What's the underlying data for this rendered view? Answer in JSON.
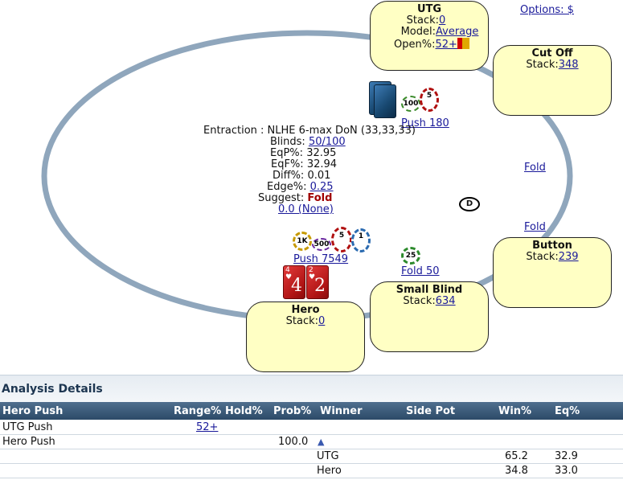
{
  "options_link": "Options: $",
  "seats": {
    "utg": {
      "name": "UTG",
      "stack_label": "Stack:",
      "stack": "0",
      "model_label": "Model:",
      "model": "Average",
      "open_label": "Open%:",
      "open": "52+"
    },
    "cutoff": {
      "name": "Cut Off",
      "stack_label": "Stack:",
      "stack": "348"
    },
    "button": {
      "name": "Button",
      "stack_label": "Stack:",
      "stack": "239"
    },
    "small_blind": {
      "name": "Small Blind",
      "stack_label": "Stack:",
      "stack": "634"
    },
    "hero": {
      "name": "Hero",
      "stack_label": "Stack:",
      "stack": "0"
    }
  },
  "actions": {
    "utg": "Push 180",
    "cutoff": "Fold",
    "button": "Fold",
    "small_blind": "Fold 50",
    "hero": "Push 7549"
  },
  "chips": {
    "utg": [
      "100",
      "5"
    ],
    "small_blind": [
      "25"
    ],
    "hero": [
      "1K",
      "500",
      "5",
      "1"
    ]
  },
  "hero_cards": [
    {
      "rank": "4",
      "suit": "♥"
    },
    {
      "rank": "2",
      "suit": "♥"
    }
  ],
  "dealer_label": "D",
  "info": {
    "title": "Entraction : NLHE 6-max DoN (33,33,33)",
    "blinds_label": "Blinds:",
    "blinds": "50/100",
    "eqp_label": "EqP%:",
    "eqp": "32.95",
    "eqf_label": "EqF%:",
    "eqf": "32.94",
    "diff_label": "Diff%:",
    "diff": "0.01",
    "edge_label": "Edge%:",
    "edge": "0.25",
    "suggest_label": "Suggest:",
    "suggest": "Fold",
    "bottom_link": "0.0 (None)"
  },
  "analysis": {
    "title": "Analysis Details",
    "columns": [
      "Hero Push",
      "Range%",
      "Hold%",
      "Prob%",
      "Winner",
      "Side Pot",
      "Win%",
      "Eq%"
    ],
    "rows": [
      {
        "name": "UTG Push",
        "range": "52+",
        "hold": "",
        "prob": "",
        "winner": "",
        "side_pot": "",
        "win": "",
        "eq": ""
      },
      {
        "name": "Hero Push",
        "range": "",
        "hold": "",
        "prob": "100.0",
        "winner": "▲",
        "side_pot": "",
        "win": "",
        "eq": ""
      },
      {
        "name": "",
        "range": "",
        "hold": "",
        "prob": "",
        "winner": "UTG",
        "side_pot": "",
        "win": "65.2",
        "eq": "32.9"
      },
      {
        "name": "",
        "range": "",
        "hold": "",
        "prob": "",
        "winner": "Hero",
        "side_pot": "",
        "win": "34.8",
        "eq": "33.0"
      }
    ]
  },
  "colors": {
    "ring": "#8fa6bc",
    "seat_fill": "#ffffc4",
    "link": "#1a1a9a",
    "suggest": "#a00000",
    "header": "#2c4a68"
  }
}
